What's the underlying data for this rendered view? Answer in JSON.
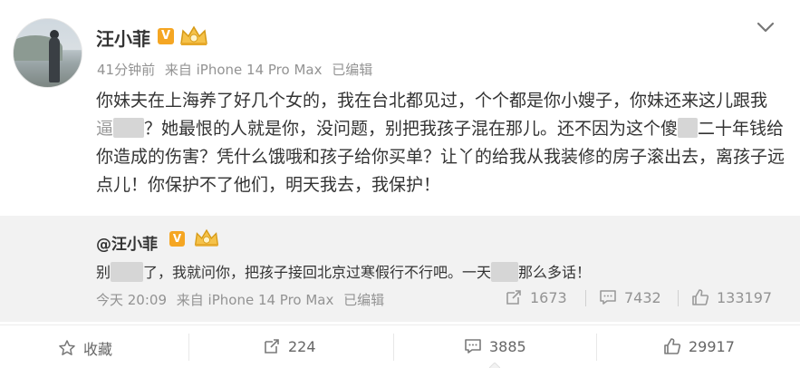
{
  "post": {
    "username": "汪小菲",
    "verified_badge": "V",
    "meta": {
      "time": "41分钟前",
      "source": "来自 iPhone 14 Pro Max",
      "edited": "已编辑"
    },
    "text_part1": "你妹夫在上海养了好几个女的，我在台北都见过，个个都是你小嫂子，你妹还来这儿跟我",
    "text_part2": "？她最恨的人就是你，没问题，别把我孩子混在那儿。还不因为这个傻",
    "text_part3": "二十年钱给你造成的伤害？凭什么饿哦和孩子给你买单？让丫的给我从我装修的房子滚出去，离孩子远点儿！你保护不了他们，明天我去，我保护！",
    "partial_char_1": "逼"
  },
  "quoted": {
    "username": "@汪小菲",
    "verified_badge": "V",
    "text_part1": "别",
    "text_part2": "了，我就问你，把孩子接回北京过寒假行不行吧。一天",
    "text_part3": "那么多话！",
    "meta": {
      "time": "今天 20:09",
      "source": "来自 iPhone 14 Pro Max",
      "edited": "已编辑"
    },
    "actions": {
      "repost": "1673",
      "comment": "7432",
      "like": "133197"
    }
  },
  "bottom_bar": {
    "favorite": "收藏",
    "repost": "224",
    "comment": "3885",
    "like": "29917"
  },
  "icons": {
    "more": "chevron-down-icon",
    "repost": "repost-icon",
    "comment": "comment-icon",
    "like": "thumbs-up-icon",
    "favorite": "star-icon"
  },
  "colors": {
    "verified": "#f5a623",
    "muted_text": "#939393",
    "quote_bg": "#f2f2f2"
  }
}
